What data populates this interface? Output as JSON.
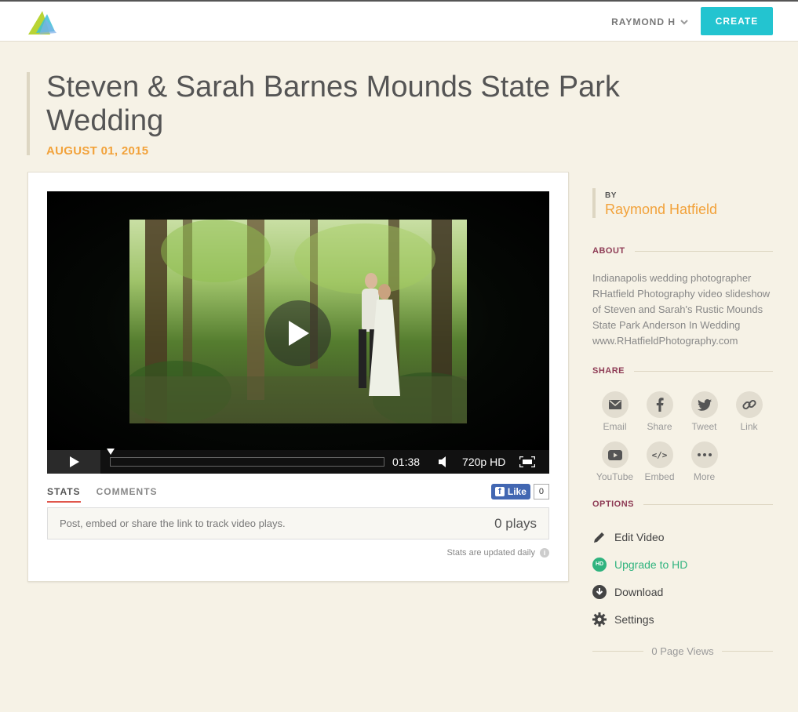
{
  "header": {
    "user_name": "RAYMOND H",
    "create_label": "CREATE"
  },
  "video": {
    "title": "Steven & Sarah Barnes Mounds State Park Wedding",
    "date": "AUGUST 01, 2015",
    "duration": "01:38",
    "quality": "720p HD",
    "progress": 0
  },
  "tabs": [
    {
      "label": "STATS",
      "active": true
    },
    {
      "label": "COMMENTS",
      "active": false
    }
  ],
  "facebook": {
    "like_label": "Like",
    "like_count": "0"
  },
  "stats": {
    "message": "Post, embed or share the link to track video plays.",
    "plays": "0 plays",
    "note": "Stats are updated daily"
  },
  "sidebar": {
    "by_label": "BY",
    "author": "Raymond Hatfield",
    "about_heading": "ABOUT",
    "about_text": "Indianapolis wedding photographer RHatfield Photography video slideshow of Steven and Sarah's Rustic Mounds State Park Anderson In Wedding www.RHatfieldPhotography.com",
    "share_heading": "SHARE",
    "share_items": [
      {
        "label": "Email",
        "icon": "envelope-icon"
      },
      {
        "label": "Share",
        "icon": "facebook-icon"
      },
      {
        "label": "Tweet",
        "icon": "twitter-icon"
      },
      {
        "label": "Link",
        "icon": "link-icon"
      },
      {
        "label": "YouTube",
        "icon": "youtube-icon"
      },
      {
        "label": "Embed",
        "icon": "code-icon"
      },
      {
        "label": "More",
        "icon": "more-icon"
      }
    ],
    "options_heading": "OPTIONS",
    "options": [
      {
        "label": "Edit Video",
        "icon": "pencil-icon"
      },
      {
        "label": "Upgrade to HD",
        "icon": "hd-badge-icon"
      },
      {
        "label": "Download",
        "icon": "download-icon"
      },
      {
        "label": "Settings",
        "icon": "gear-icon"
      }
    ],
    "page_views": "0 Page Views"
  },
  "colors": {
    "background": "#f6f2e6",
    "accent_cyan": "#23c4d0",
    "accent_orange": "#f2a23a",
    "section_heading": "#8e3b55",
    "upgrade_green": "#2fb37e"
  }
}
